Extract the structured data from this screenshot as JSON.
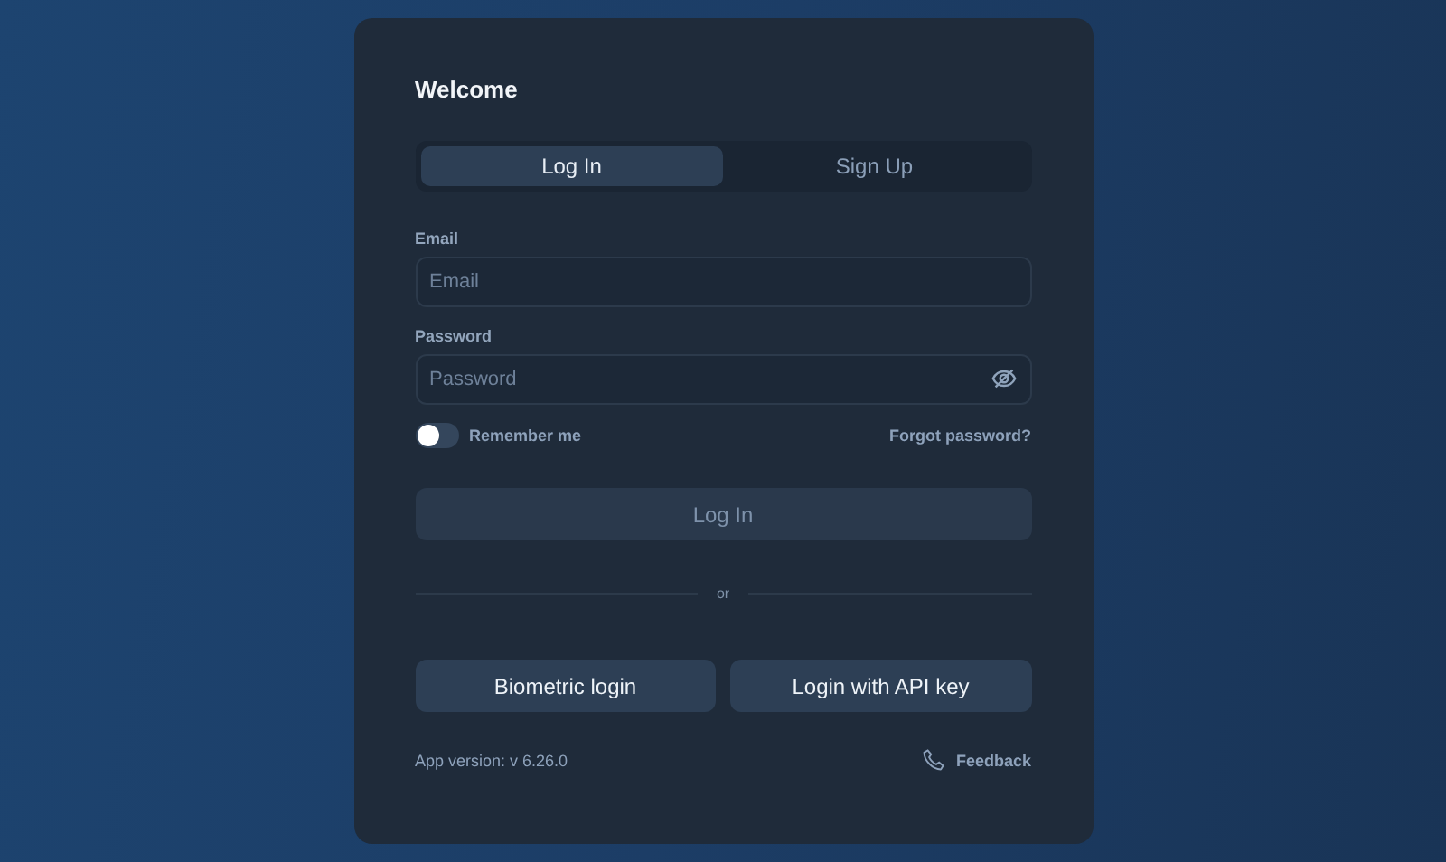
{
  "title": "Welcome",
  "tabs": [
    {
      "label": "Log In",
      "selected": true
    },
    {
      "label": "Sign Up",
      "selected": false
    }
  ],
  "fields": [
    {
      "label": "Email",
      "placeholder": "Email",
      "kind": "text"
    },
    {
      "label": "Password",
      "placeholder": "Password",
      "kind": "password"
    }
  ],
  "remember": {
    "label": "Remember me",
    "on": false
  },
  "forgot_link": "Forgot password?",
  "submit": {
    "label": "Log In",
    "disabled": true
  },
  "divider": "or",
  "alt_buttons": [
    "Biometric login",
    "Login with API key"
  ],
  "version": "App version: v 6.26.0",
  "feedback": "Feedback"
}
